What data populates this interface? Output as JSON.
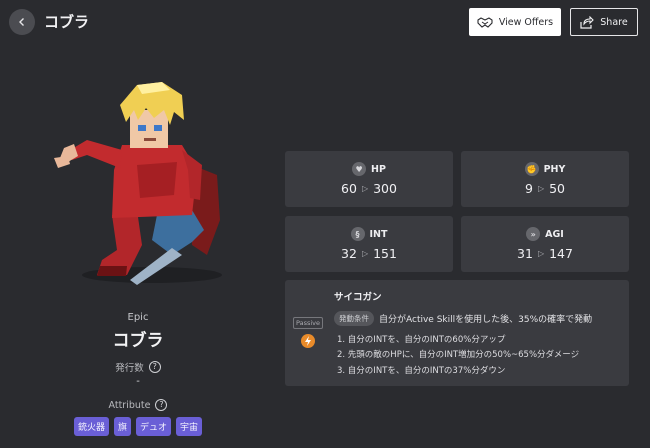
{
  "header": {
    "title": "コブラ",
    "view_offers_label": "View Offers",
    "share_label": "Share"
  },
  "character": {
    "rarity": "Epic",
    "name": "コブラ",
    "issue_count_label": "発行数",
    "issue_count_value": "-",
    "attribute_label": "Attribute",
    "attributes": [
      "銃火器",
      "旗",
      "デュオ",
      "宇宙"
    ]
  },
  "stats": [
    {
      "key": "HP",
      "icon": "heart-icon",
      "from": "60",
      "to": "300"
    },
    {
      "key": "PHY",
      "icon": "hand-icon",
      "from": "9",
      "to": "50"
    },
    {
      "key": "INT",
      "icon": "brain-icon",
      "from": "32",
      "to": "151"
    },
    {
      "key": "AGI",
      "icon": "dash-icon",
      "from": "31",
      "to": "147"
    }
  ],
  "skill": {
    "name": "サイコガン",
    "type": "Passive",
    "condition_badge": "発動条件",
    "condition_text": "自分がActive Skillを使用した後、35%の確率で発動",
    "effects": [
      "1. 自分のINTを、自分のINTの60%分アップ",
      "2. 先頭の敵のHPに、自分のINT増加分の50%~65%分ダメージ",
      "3. 自分のINTを、自分のINTの37%分ダウン"
    ]
  },
  "colors": {
    "background": "#2a2b2f",
    "card": "#3a3b40",
    "tag": "#6a5fd6",
    "skill_icon": "#e98b2a"
  }
}
